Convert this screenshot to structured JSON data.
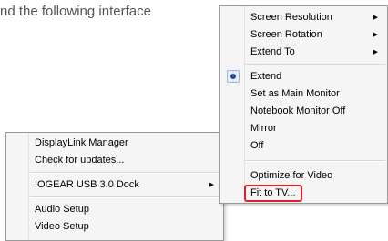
{
  "doc": {
    "text": "nd the following interface"
  },
  "taskbar_menu": {
    "items": [
      {
        "label": "DisplayLink Manager"
      },
      {
        "label": "Check for updates..."
      },
      {
        "label": "IOGEAR  USB 3.0 Dock"
      },
      {
        "label": "Audio Setup"
      },
      {
        "label": "Video Setup"
      }
    ]
  },
  "submenu": {
    "items": [
      {
        "label": "Screen Resolution"
      },
      {
        "label": "Screen Rotation"
      },
      {
        "label": "Extend To"
      },
      {
        "label": "Extend"
      },
      {
        "label": "Set as Main Monitor"
      },
      {
        "label": "Notebook Monitor Off"
      },
      {
        "label": "Mirror"
      },
      {
        "label": "Off"
      },
      {
        "label": "Optimize for Video"
      },
      {
        "label": "Fit to TV..."
      }
    ]
  },
  "colors": {
    "highlight": "#e0202a",
    "radio": "#1f4a9a"
  },
  "icons": {
    "submenu_arrow": "submenu-arrow-icon",
    "selected_radio": "radio-selected-icon"
  }
}
